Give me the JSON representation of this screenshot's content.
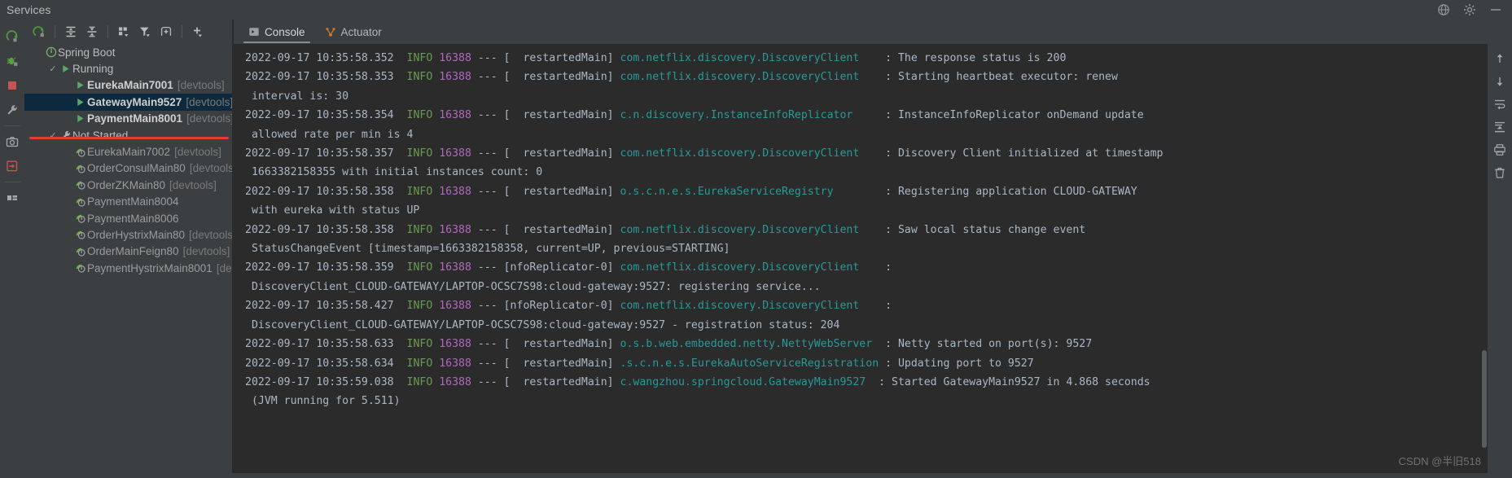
{
  "window": {
    "title": "Services",
    "title_icons": [
      {
        "name": "settings-sync-icon",
        "glyph": "globe"
      },
      {
        "name": "gear-icon",
        "glyph": "gear"
      },
      {
        "name": "hide-icon",
        "glyph": "minus"
      }
    ]
  },
  "left_strip": [
    {
      "name": "run-icon",
      "glyph": "run"
    },
    {
      "name": "debug-icon",
      "glyph": "debug"
    },
    {
      "name": "stop-icon",
      "glyph": "stop"
    },
    {
      "name": "wrench-icon",
      "glyph": "wrench"
    },
    {
      "name": "camera-icon",
      "glyph": "camera"
    },
    {
      "name": "attach-icon",
      "glyph": "attach"
    },
    {
      "name": "layout-icon",
      "glyph": "layout"
    }
  ],
  "services_toolbar": [
    {
      "name": "rerun-button",
      "glyph": "rerun",
      "tooltip": "Rerun"
    },
    {
      "name": "expand-all-button",
      "glyph": "expand-all",
      "tooltip": "Expand All"
    },
    {
      "name": "collapse-all-button",
      "glyph": "collapse-all",
      "tooltip": "Collapse All"
    },
    {
      "name": "group-by-button",
      "glyph": "group-by",
      "tooltip": "Group By"
    },
    {
      "name": "filter-button",
      "glyph": "filter",
      "tooltip": "Filter"
    },
    {
      "name": "show-configurations-button",
      "glyph": "add-frame",
      "tooltip": "Show Configurations"
    },
    {
      "name": "add-service-button",
      "glyph": "plus",
      "tooltip": "Add Service"
    }
  ],
  "tree": [
    {
      "label": "Spring Boot",
      "devtools": "",
      "depth": 0,
      "icon": "spring-boot-icon",
      "check": "",
      "state": "group",
      "selected": false
    },
    {
      "label": "Running",
      "devtools": "",
      "depth": 1,
      "icon": "run-green-icon",
      "check": "✓",
      "state": "group",
      "selected": false
    },
    {
      "label": "EurekaMain7001",
      "devtools": "[devtools]",
      "depth": 2,
      "icon": "run-green-icon",
      "check": "",
      "state": "running",
      "selected": false
    },
    {
      "label": "GatewayMain9527",
      "devtools": "[devtools]",
      "depth": 2,
      "icon": "run-green-icon",
      "check": "",
      "state": "running",
      "selected": true
    },
    {
      "label": "PaymentMain8001",
      "devtools": "[devtools]",
      "depth": 2,
      "icon": "run-green-icon",
      "check": "",
      "state": "running",
      "selected": false
    },
    {
      "label": "Not Started",
      "devtools": "",
      "depth": 1,
      "icon": "wrench-grey-icon",
      "check": "✓",
      "state": "group",
      "selected": false
    },
    {
      "label": "EurekaMain7002",
      "devtools": "[devtools]",
      "depth": 2,
      "icon": "spring-leaf-icon",
      "check": "",
      "state": "stopped",
      "selected": false
    },
    {
      "label": "OrderConsulMain80",
      "devtools": "[devtools]",
      "depth": 2,
      "icon": "spring-leaf-icon",
      "check": "",
      "state": "stopped",
      "selected": false
    },
    {
      "label": "OrderZKMain80",
      "devtools": "[devtools]",
      "depth": 2,
      "icon": "spring-leaf-icon",
      "check": "",
      "state": "stopped",
      "selected": false
    },
    {
      "label": "PaymentMain8004",
      "devtools": "",
      "depth": 2,
      "icon": "spring-leaf-icon",
      "check": "",
      "state": "stopped",
      "selected": false
    },
    {
      "label": "PaymentMain8006",
      "devtools": "",
      "depth": 2,
      "icon": "spring-leaf-icon",
      "check": "",
      "state": "stopped",
      "selected": false
    },
    {
      "label": "OrderHystrixMain80",
      "devtools": "[devtools]",
      "depth": 2,
      "icon": "spring-leaf-icon",
      "check": "",
      "state": "stopped",
      "selected": false
    },
    {
      "label": "OrderMainFeign80",
      "devtools": "[devtools]",
      "depth": 2,
      "icon": "spring-leaf-icon",
      "check": "",
      "state": "stopped",
      "selected": false
    },
    {
      "label": "PaymentHystrixMain8001",
      "devtools": "[devtoo",
      "depth": 2,
      "icon": "spring-leaf-icon",
      "check": "",
      "state": "stopped",
      "selected": false
    }
  ],
  "tabs": [
    {
      "label": "Console",
      "icon": "console-icon",
      "active": true
    },
    {
      "label": "Actuator",
      "icon": "actuator-icon",
      "active": false
    }
  ],
  "console": {
    "lines": [
      [
        {
          "t": "ts",
          "v": "2022-09-17 10:35:58.352  "
        },
        {
          "t": "info",
          "v": "INFO"
        },
        {
          "t": "ts",
          "v": " "
        },
        {
          "t": "pid",
          "v": "16388"
        },
        {
          "t": "ts",
          "v": " --- [  restartedMain] "
        },
        {
          "t": "cls",
          "v": "com.netflix.discovery.DiscoveryClient"
        },
        {
          "t": "msg",
          "v": "    : The response status is 200"
        }
      ],
      [
        {
          "t": "ts",
          "v": "2022-09-17 10:35:58.353  "
        },
        {
          "t": "info",
          "v": "INFO"
        },
        {
          "t": "ts",
          "v": " "
        },
        {
          "t": "pid",
          "v": "16388"
        },
        {
          "t": "ts",
          "v": " --- [  restartedMain] "
        },
        {
          "t": "cls",
          "v": "com.netflix.discovery.DiscoveryClient"
        },
        {
          "t": "msg",
          "v": "    : Starting heartbeat executor: renew"
        }
      ],
      [
        {
          "t": "msg",
          "v": " interval is: 30"
        }
      ],
      [
        {
          "t": "ts",
          "v": "2022-09-17 10:35:58.354  "
        },
        {
          "t": "info",
          "v": "INFO"
        },
        {
          "t": "ts",
          "v": " "
        },
        {
          "t": "pid",
          "v": "16388"
        },
        {
          "t": "ts",
          "v": " --- [  restartedMain] "
        },
        {
          "t": "cls",
          "v": "c.n.discovery.InstanceInfoReplicator"
        },
        {
          "t": "msg",
          "v": "     : InstanceInfoReplicator onDemand update"
        }
      ],
      [
        {
          "t": "msg",
          "v": " allowed rate per min is 4"
        }
      ],
      [
        {
          "t": "ts",
          "v": "2022-09-17 10:35:58.357  "
        },
        {
          "t": "info",
          "v": "INFO"
        },
        {
          "t": "ts",
          "v": " "
        },
        {
          "t": "pid",
          "v": "16388"
        },
        {
          "t": "ts",
          "v": " --- [  restartedMain] "
        },
        {
          "t": "cls",
          "v": "com.netflix.discovery.DiscoveryClient"
        },
        {
          "t": "msg",
          "v": "    : Discovery Client initialized at timestamp"
        }
      ],
      [
        {
          "t": "msg",
          "v": " 1663382158355 with initial instances count: 0"
        }
      ],
      [
        {
          "t": "ts",
          "v": "2022-09-17 10:35:58.358  "
        },
        {
          "t": "info",
          "v": "INFO"
        },
        {
          "t": "ts",
          "v": " "
        },
        {
          "t": "pid",
          "v": "16388"
        },
        {
          "t": "ts",
          "v": " --- [  restartedMain] "
        },
        {
          "t": "cls",
          "v": "o.s.c.n.e.s.EurekaServiceRegistry"
        },
        {
          "t": "msg",
          "v": "        : Registering application CLOUD-GATEWAY"
        }
      ],
      [
        {
          "t": "msg",
          "v": " with eureka with status UP"
        }
      ],
      [
        {
          "t": "ts",
          "v": "2022-09-17 10:35:58.358  "
        },
        {
          "t": "info",
          "v": "INFO"
        },
        {
          "t": "ts",
          "v": " "
        },
        {
          "t": "pid",
          "v": "16388"
        },
        {
          "t": "ts",
          "v": " --- [  restartedMain] "
        },
        {
          "t": "cls",
          "v": "com.netflix.discovery.DiscoveryClient"
        },
        {
          "t": "msg",
          "v": "    : Saw local status change event"
        }
      ],
      [
        {
          "t": "msg",
          "v": " StatusChangeEvent [timestamp=1663382158358, current=UP, previous=STARTING]"
        }
      ],
      [
        {
          "t": "ts",
          "v": "2022-09-17 10:35:58.359  "
        },
        {
          "t": "info",
          "v": "INFO"
        },
        {
          "t": "ts",
          "v": " "
        },
        {
          "t": "pid",
          "v": "16388"
        },
        {
          "t": "ts",
          "v": " --- [nfoReplicator-0] "
        },
        {
          "t": "cls",
          "v": "com.netflix.discovery.DiscoveryClient"
        },
        {
          "t": "msg",
          "v": "    :"
        }
      ],
      [
        {
          "t": "msg",
          "v": " DiscoveryClient_CLOUD-GATEWAY/LAPTOP-OCSC7S98:cloud-gateway:9527: registering service..."
        }
      ],
      [
        {
          "t": "ts",
          "v": "2022-09-17 10:35:58.427  "
        },
        {
          "t": "info",
          "v": "INFO"
        },
        {
          "t": "ts",
          "v": " "
        },
        {
          "t": "pid",
          "v": "16388"
        },
        {
          "t": "ts",
          "v": " --- [nfoReplicator-0] "
        },
        {
          "t": "cls",
          "v": "com.netflix.discovery.DiscoveryClient"
        },
        {
          "t": "msg",
          "v": "    :"
        }
      ],
      [
        {
          "t": "msg",
          "v": " DiscoveryClient_CLOUD-GATEWAY/LAPTOP-OCSC7S98:cloud-gateway:9527 - registration status: 204"
        }
      ],
      [
        {
          "t": "ts",
          "v": "2022-09-17 10:35:58.633  "
        },
        {
          "t": "info",
          "v": "INFO"
        },
        {
          "t": "ts",
          "v": " "
        },
        {
          "t": "pid",
          "v": "16388"
        },
        {
          "t": "ts",
          "v": " --- [  restartedMain] "
        },
        {
          "t": "cls",
          "v": "o.s.b.web.embedded.netty.NettyWebServer"
        },
        {
          "t": "msg",
          "v": "  : Netty started on port(s): 9527"
        }
      ],
      [
        {
          "t": "ts",
          "v": "2022-09-17 10:35:58.634  "
        },
        {
          "t": "info",
          "v": "INFO"
        },
        {
          "t": "ts",
          "v": " "
        },
        {
          "t": "pid",
          "v": "16388"
        },
        {
          "t": "ts",
          "v": " --- [  restartedMain] "
        },
        {
          "t": "cls",
          "v": ".s.c.n.e.s.EurekaAutoServiceRegistration"
        },
        {
          "t": "msg",
          "v": " : Updating port to 9527"
        }
      ],
      [
        {
          "t": "ts",
          "v": "2022-09-17 10:35:59.038  "
        },
        {
          "t": "info",
          "v": "INFO"
        },
        {
          "t": "ts",
          "v": " "
        },
        {
          "t": "pid",
          "v": "16388"
        },
        {
          "t": "ts",
          "v": " --- [  restartedMain] "
        },
        {
          "t": "cls",
          "v": "c.wangzhou.springcloud.GatewayMain9527"
        },
        {
          "t": "msg",
          "v": "  : Started GatewayMain9527 in 4.868 seconds"
        }
      ],
      [
        {
          "t": "msg",
          "v": " (JVM running for 5.511)"
        }
      ]
    ]
  },
  "right_tools": [
    {
      "name": "scroll-up-icon",
      "glyph": "arrow-up"
    },
    {
      "name": "scroll-down-icon",
      "glyph": "arrow-down"
    },
    {
      "name": "soft-wrap-icon",
      "glyph": "wrap"
    },
    {
      "name": "scroll-to-end-icon",
      "glyph": "scroll-end"
    },
    {
      "name": "print-icon",
      "glyph": "print"
    },
    {
      "name": "clear-all-icon",
      "glyph": "trash"
    }
  ],
  "watermark": "CSDN @半旧518",
  "colors": {
    "panel_bg": "#3c3f41",
    "console_bg": "#2b2b2b",
    "selection_bg": "#0d293e",
    "accent_green": "#6a9a52",
    "accent_cyan": "#299999",
    "accent_purple": "#b069bd",
    "annotation_red": "#e33b2e",
    "text": "#a9b7c6"
  }
}
